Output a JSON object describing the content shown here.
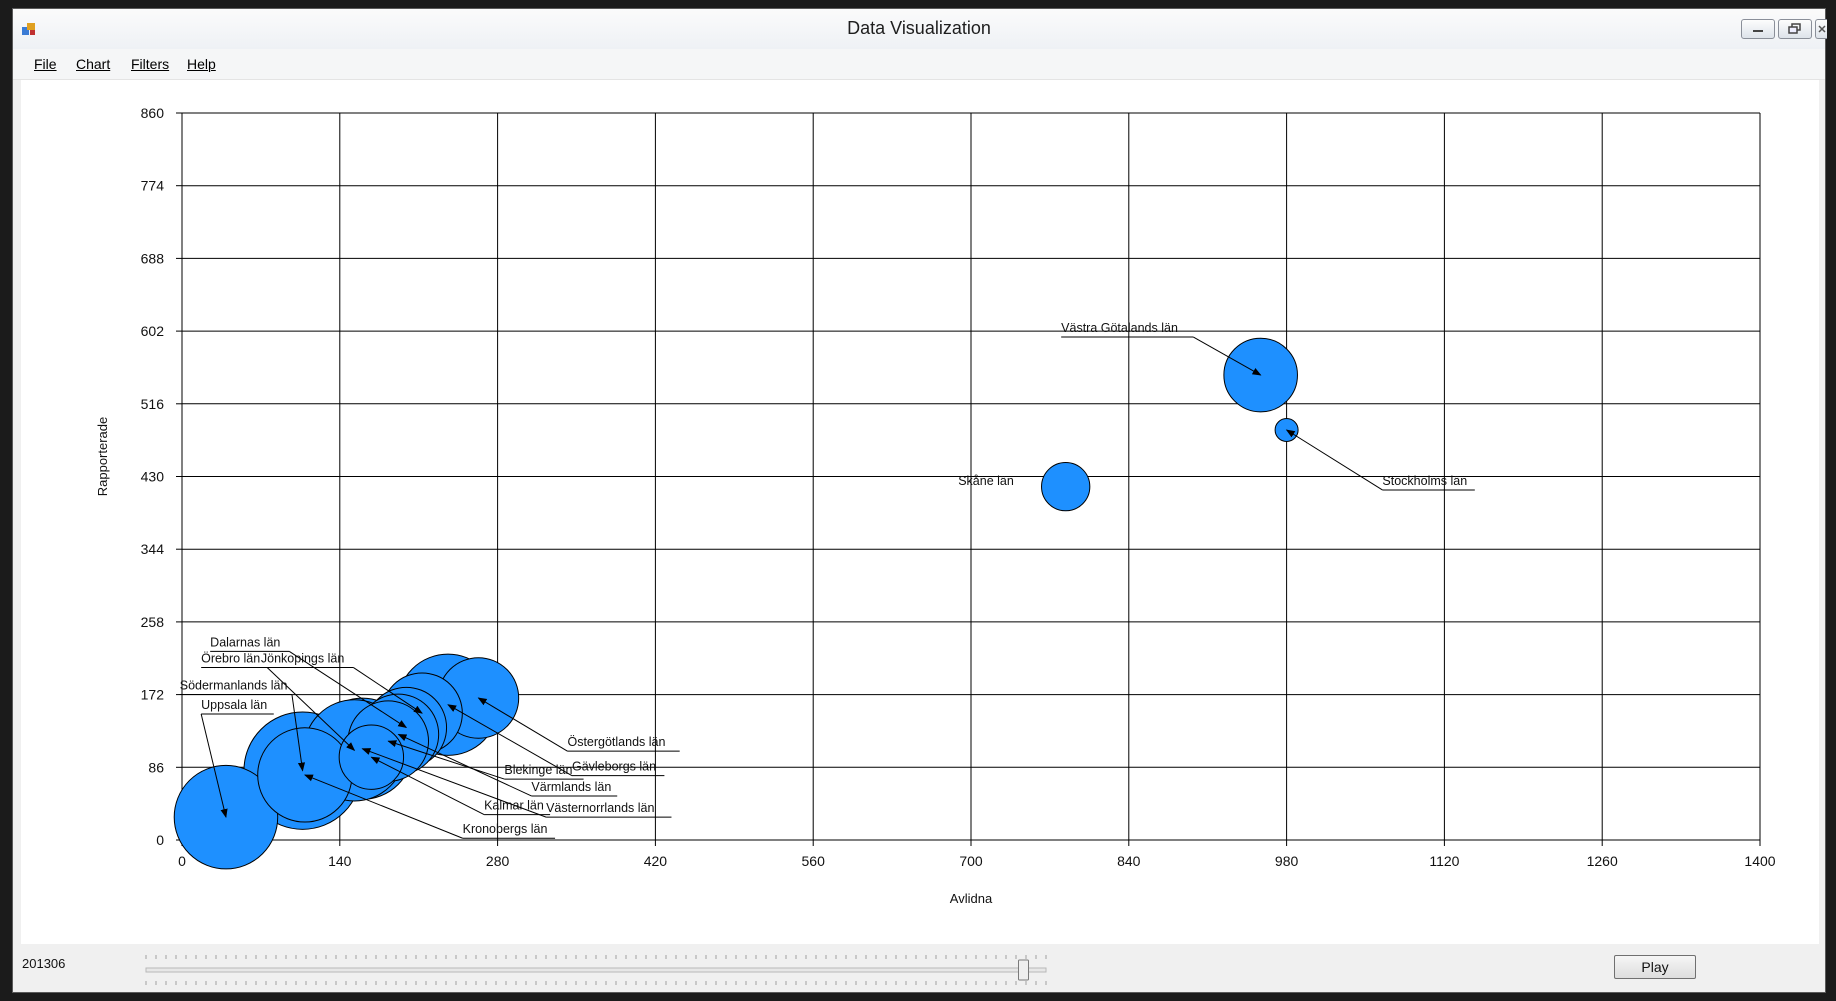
{
  "window": {
    "title": "Data Visualization"
  },
  "menu": [
    {
      "label": "File"
    },
    {
      "label": "Chart"
    },
    {
      "label": "Filters"
    },
    {
      "label": "Help"
    }
  ],
  "controls": {
    "period": "201306",
    "play_label": "Play",
    "slider_value": 0.975
  },
  "chart_data": {
    "type": "bubble",
    "xlabel": "Avlidna",
    "ylabel": "Rapporterade",
    "xlim": [
      0,
      1400
    ],
    "ylim": [
      0,
      860
    ],
    "xticks": [
      "0",
      "140",
      "280",
      "420",
      "560",
      "700",
      "840",
      "980",
      "1120",
      "1260",
      "1400"
    ],
    "yticks": [
      "0",
      "86",
      "172",
      "258",
      "344",
      "430",
      "516",
      "602",
      "688",
      "774",
      "860"
    ],
    "grid": true,
    "bubble_color": "#1e90ff",
    "points": [
      {
        "label": "Västra Götalands län",
        "x": 957,
        "y": 550,
        "size": 3.2,
        "annotated": true
      },
      {
        "label": "Stockholms län",
        "x": 980,
        "y": 485,
        "size": 1.0,
        "annotated": true
      },
      {
        "label": "Skåne län",
        "x": 784,
        "y": 418,
        "size": 2.1,
        "annotated": false
      },
      {
        "label": "Östergötlands län",
        "x": 263,
        "y": 168,
        "size": 3.5,
        "annotated": true
      },
      {
        "label": "Gävleborgs län",
        "x": 236,
        "y": 160,
        "size": 4.4,
        "annotated": true
      },
      {
        "label": "Jönkopings län",
        "x": 213,
        "y": 150,
        "size": 3.5,
        "annotated": true
      },
      {
        "label": "Dalarnas län",
        "x": 199,
        "y": 133,
        "size": 3.5,
        "annotated": true
      },
      {
        "label": "Värmlands län",
        "x": 192,
        "y": 125,
        "size": 3.5,
        "annotated": true
      },
      {
        "label": "Blekinge län",
        "x": 183,
        "y": 117,
        "size": 3.5,
        "annotated": true
      },
      {
        "label": "Västernorrlands län",
        "x": 160,
        "y": 108,
        "size": 4.4,
        "annotated": true
      },
      {
        "label": "Örebro län",
        "x": 153,
        "y": 106,
        "size": 4.4,
        "annotated": true
      },
      {
        "label": "Kalmar län",
        "x": 168,
        "y": 98,
        "size": 2.8,
        "annotated": true
      },
      {
        "label": "Södermanlands län",
        "x": 107,
        "y": 82,
        "size": 5.1,
        "annotated": true
      },
      {
        "label": "Kronobergs län",
        "x": 109,
        "y": 77,
        "size": 4.1,
        "annotated": true
      },
      {
        "label": "Uppsala län",
        "x": 39,
        "y": 27,
        "size": 4.5,
        "annotated": true
      }
    ],
    "labels": [
      {
        "for": "Västra Götalands län",
        "x": 780,
        "y": 601,
        "anchor": "start",
        "leader": true
      },
      {
        "for": "Stockholms län",
        "x": 1065,
        "y": 420,
        "anchor": "start",
        "leader": true
      },
      {
        "for": "Skåne län",
        "x": 738,
        "y": 420,
        "anchor": "end",
        "leader": false
      },
      {
        "for": "Dalarnas län",
        "x": 25,
        "y": 229,
        "anchor": "start",
        "leader": true
      },
      {
        "for": "Örebro län",
        "x": 17,
        "y": 210,
        "anchor": "start",
        "leader": true
      },
      {
        "for": "Jönkopings län",
        "x": 70,
        "y": 210,
        "anchor": "start",
        "leader": true
      },
      {
        "for": "Södermanlands län",
        "x": -2,
        "y": 178,
        "anchor": "start",
        "leader": true
      },
      {
        "for": "Uppsala län",
        "x": 17,
        "y": 155,
        "anchor": "start",
        "leader": true
      },
      {
        "for": "Östergötlands län",
        "x": 342,
        "y": 111,
        "anchor": "start",
        "leader": true
      },
      {
        "for": "Gävleborgs län",
        "x": 346,
        "y": 82,
        "anchor": "start",
        "leader": true
      },
      {
        "for": "Blekinge län",
        "x": 286,
        "y": 78,
        "anchor": "start",
        "leader": true
      },
      {
        "for": "Värmlands län",
        "x": 310,
        "y": 58,
        "anchor": "start",
        "leader": true
      },
      {
        "for": "Kalmar län",
        "x": 268,
        "y": 36,
        "anchor": "start",
        "leader": true
      },
      {
        "for": "Västernorrlands län",
        "x": 323,
        "y": 33,
        "anchor": "start",
        "leader": true
      },
      {
        "for": "Kronobergs län",
        "x": 249,
        "y": 8,
        "anchor": "start",
        "leader": true
      }
    ]
  }
}
